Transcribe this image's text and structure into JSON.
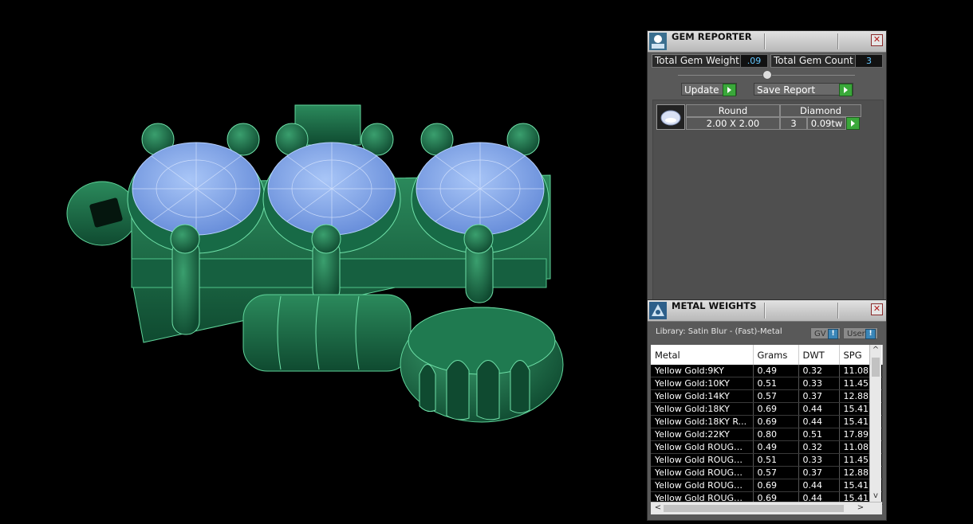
{
  "gem_reporter": {
    "title": "GEM REPORTER",
    "close_glyph": "✕",
    "total_gem_weight_label": "Total Gem Weight",
    "total_gem_weight_value": ".09",
    "total_gem_count_label": "Total Gem Count",
    "total_gem_count_value": "3",
    "update_label": "Update",
    "save_report_label": "Save Report",
    "gem_row": {
      "shape": "Round",
      "type": "Diamond",
      "size": "2.00 X 2.00",
      "count": "3",
      "weight": "0.09tw"
    }
  },
  "metal_weights": {
    "title": "METAL WEIGHTS",
    "close_glyph": "✕",
    "library_text": "Library: Satin Blur - (Fast)-Metal",
    "gv_toggle": "GV",
    "user_toggle": "User",
    "info_glyph": "!",
    "columns": [
      "Metal",
      "Grams",
      "DWT",
      "SPG"
    ],
    "rows": [
      [
        "Yellow Gold:9KY",
        "0.49",
        "0.32",
        "11.08"
      ],
      [
        "Yellow Gold:10KY",
        "0.51",
        "0.33",
        "11.45"
      ],
      [
        "Yellow Gold:14KY",
        "0.57",
        "0.37",
        "12.88"
      ],
      [
        "Yellow Gold:18KY",
        "0.69",
        "0.44",
        "15.41"
      ],
      [
        "Yellow Gold:18KY R...",
        "0.69",
        "0.44",
        "15.41"
      ],
      [
        "Yellow Gold:22KY",
        "0.80",
        "0.51",
        "17.89"
      ],
      [
        "Yellow Gold ROUGH...",
        "0.49",
        "0.32",
        "11.08"
      ],
      [
        "Yellow Gold ROUGH...",
        "0.51",
        "0.33",
        "11.45"
      ],
      [
        "Yellow Gold ROUGH...",
        "0.57",
        "0.37",
        "12.88"
      ],
      [
        "Yellow Gold ROUGH...",
        "0.69",
        "0.44",
        "15.41"
      ],
      [
        "Yellow Gold ROUGH...",
        "0.69",
        "0.44",
        "15.41"
      ]
    ],
    "scroll_up": "^",
    "scroll_down": "v",
    "scroll_left": "<",
    "scroll_right": ">"
  },
  "colors": {
    "model_green": "#1f6e4a",
    "gem_blue": "#7fa8f0",
    "accent_green": "#3aa83a",
    "value_blue": "#66c8ff"
  }
}
